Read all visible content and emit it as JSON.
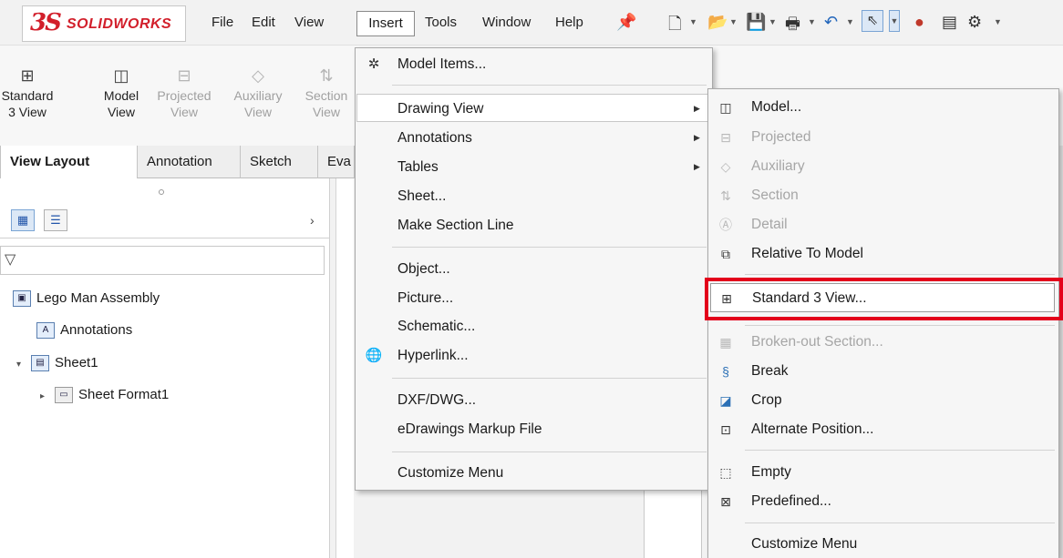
{
  "app": {
    "logo_ds": "3S",
    "logo_text": "SOLIDWORKS"
  },
  "menubar": {
    "items": [
      "File",
      "Edit",
      "View",
      "Insert",
      "Tools",
      "Window",
      "Help"
    ],
    "active": "Insert"
  },
  "toolbar_icons": [
    "pin-icon",
    "new-document-icon",
    "open-icon",
    "save-icon",
    "print-icon",
    "undo-icon",
    "select-icon",
    "rebuild-icon",
    "file-properties-icon",
    "options-icon"
  ],
  "command_manager": {
    "buttons": [
      {
        "line1": "Standard",
        "line2": "3 View",
        "enabled": true,
        "icon": "standard-3-view-icon"
      },
      {
        "line1": "Model",
        "line2": "View",
        "enabled": true,
        "icon": "model-view-icon"
      },
      {
        "line1": "Projected",
        "line2": "View",
        "enabled": false,
        "icon": "projected-view-icon"
      },
      {
        "line1": "Auxiliary",
        "line2": "View",
        "enabled": false,
        "icon": "auxiliary-view-icon"
      },
      {
        "line1": "Section",
        "line2": "View",
        "enabled": false,
        "icon": "section-view-icon"
      }
    ]
  },
  "tabs": [
    "View Layout",
    "Annotation",
    "Sketch",
    "Eva"
  ],
  "active_tab": "View Layout",
  "feature_tree": {
    "items": [
      {
        "label": "Lego Man Assembly",
        "level": 0,
        "arrow": "",
        "icon": "drawing-icon"
      },
      {
        "label": "Annotations",
        "level": 1,
        "arrow": "",
        "icon": "annotations-icon"
      },
      {
        "label": "Sheet1",
        "level": 0,
        "arrow": "▾",
        "icon": "sheet-icon"
      },
      {
        "label": "Sheet Format1",
        "level": 1,
        "arrow": "▸",
        "icon": "sheet-format-icon"
      }
    ]
  },
  "insert_menu": {
    "items": [
      {
        "label": "Model Items...",
        "icon": "model-items-icon",
        "submenu": false
      },
      {
        "label": "Drawing View",
        "icon": "",
        "submenu": true,
        "highlighted": true
      },
      {
        "label": "Annotations",
        "icon": "",
        "submenu": true
      },
      {
        "label": "Tables",
        "icon": "",
        "submenu": true
      },
      {
        "label": "Sheet...",
        "icon": "",
        "submenu": false
      },
      {
        "label": "Make Section Line",
        "icon": "",
        "submenu": false
      },
      {
        "label": "Object...",
        "icon": "",
        "submenu": false
      },
      {
        "label": "Picture...",
        "icon": "",
        "submenu": false
      },
      {
        "label": "Schematic...",
        "icon": "",
        "submenu": false
      },
      {
        "label": "Hyperlink...",
        "icon": "hyperlink-icon",
        "submenu": false
      },
      {
        "label": "DXF/DWG...",
        "icon": "",
        "submenu": false
      },
      {
        "label": "eDrawings Markup File",
        "icon": "",
        "submenu": false
      },
      {
        "label": "Customize Menu",
        "icon": "",
        "submenu": false
      }
    ]
  },
  "drawing_view_submenu": {
    "items": [
      {
        "label": "Model...",
        "enabled": true,
        "icon": "model-view-icon"
      },
      {
        "label": "Projected",
        "enabled": false,
        "icon": "projected-view-icon"
      },
      {
        "label": "Auxiliary",
        "enabled": false,
        "icon": "auxiliary-view-icon"
      },
      {
        "label": "Section",
        "enabled": false,
        "icon": "section-view-icon"
      },
      {
        "label": "Detail",
        "enabled": false,
        "icon": "detail-view-icon"
      },
      {
        "label": "Relative To Model",
        "enabled": true,
        "icon": "relative-view-icon"
      },
      {
        "label": "Standard 3 View...",
        "enabled": true,
        "icon": "standard-3-view-icon",
        "highlighted": true
      },
      {
        "label": "Broken-out Section...",
        "enabled": false,
        "icon": "broken-out-section-icon"
      },
      {
        "label": "Break",
        "enabled": true,
        "icon": "break-icon"
      },
      {
        "label": "Crop",
        "enabled": true,
        "icon": "crop-icon"
      },
      {
        "label": "Alternate Position...",
        "enabled": true,
        "icon": "alternate-position-icon"
      },
      {
        "label": "Empty",
        "enabled": true,
        "icon": "empty-view-icon"
      },
      {
        "label": "Predefined...",
        "enabled": true,
        "icon": "predefined-view-icon"
      },
      {
        "label": "Customize Menu",
        "enabled": true,
        "icon": ""
      }
    ]
  },
  "colors": {
    "brand_red": "#d21f2b",
    "highlight_box": "#e3001b"
  }
}
